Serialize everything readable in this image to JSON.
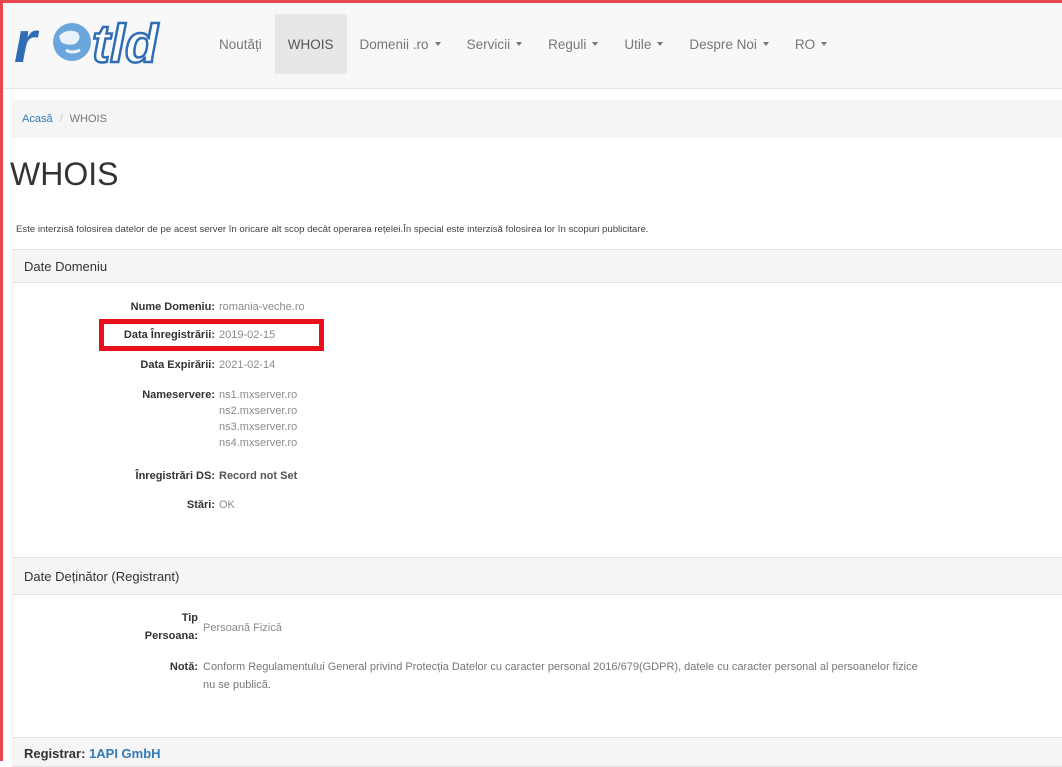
{
  "nav": {
    "logo_text": "rotld",
    "items": [
      {
        "label": "Noutăți",
        "dropdown": false,
        "active": false
      },
      {
        "label": "WHOIS",
        "dropdown": false,
        "active": true
      },
      {
        "label": "Domenii .ro",
        "dropdown": true,
        "active": false
      },
      {
        "label": "Servicii",
        "dropdown": true,
        "active": false
      },
      {
        "label": "Reguli",
        "dropdown": true,
        "active": false
      },
      {
        "label": "Utile",
        "dropdown": true,
        "active": false
      },
      {
        "label": "Despre Noi",
        "dropdown": true,
        "active": false
      },
      {
        "label": "RO",
        "dropdown": true,
        "active": false
      }
    ]
  },
  "breadcrumb": {
    "home": "Acasă",
    "separator": "/",
    "current": "WHOIS"
  },
  "page": {
    "title": "WHOIS",
    "notice": "Este interzisă folosirea datelor de pe acest server în oricare alt scop decât operarea rețelei.În special este interzisă folosirea lor în scopuri publicitare."
  },
  "domain_section": {
    "heading": "Date Domeniu",
    "fields": {
      "name_label": "Nume Domeniu:",
      "name_value": "romania-veche.ro",
      "reg_label": "Data Înregistrării:",
      "reg_value": "2019-02-15",
      "exp_label": "Data Expirării:",
      "exp_value": "2021-02-14",
      "ns_label": "Nameservere:",
      "ns": [
        "ns1.mxserver.ro",
        "ns2.mxserver.ro",
        "ns3.mxserver.ro",
        "ns4.mxserver.ro"
      ],
      "ds_label": "Înregistrări DS:",
      "ds_value": "Record not Set",
      "status_label": "Stări:",
      "status_value": "OK"
    }
  },
  "registrant_section": {
    "heading": "Date Deținător (Registrant)",
    "tip_label_1": "Tip",
    "tip_label_2": "Persoana:",
    "tip_value": "Persoană Fizică",
    "nota_label": "Notă:",
    "nota_line1": "Conform Regulamentului General privind Protecția Datelor cu caracter personal 2016/679(GDPR), datele cu caracter personal al persoanelor fizice",
    "nota_line2": "nu se publică."
  },
  "registrar": {
    "label": "Registrar:",
    "value": "1API GmbH"
  },
  "colors": {
    "accent": "#337ab7",
    "highlight": "#e8101a",
    "frame": "#e8484c"
  }
}
